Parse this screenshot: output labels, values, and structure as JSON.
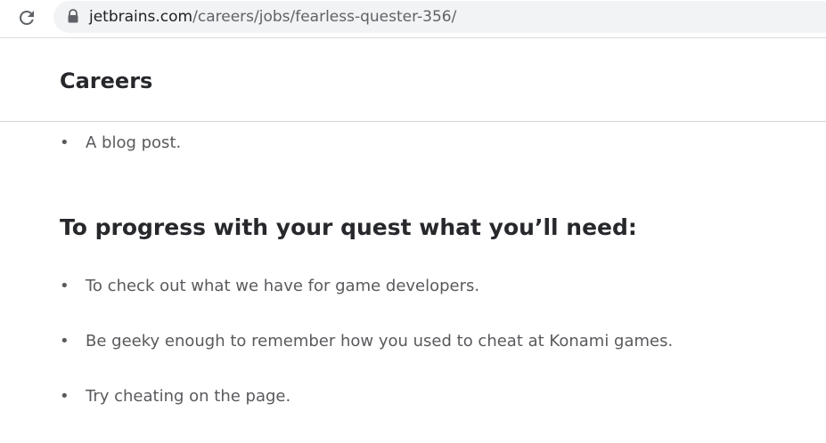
{
  "browser": {
    "url_domain": "jetbrains.com",
    "url_path": "/careers/jobs/fearless-quester-356/",
    "reload_icon": "reload-icon",
    "lock_icon": "lock-icon"
  },
  "header": {
    "title": "Careers"
  },
  "main": {
    "prev_items": [
      "A blog post."
    ],
    "section_heading": "To progress with your quest what you’ll need:",
    "items": [
      "To check out what we have for game developers.",
      "Be geeky enough to remember how you used to cheat at Konami games.",
      "Try cheating on the page."
    ],
    "bullet_char": "•"
  }
}
